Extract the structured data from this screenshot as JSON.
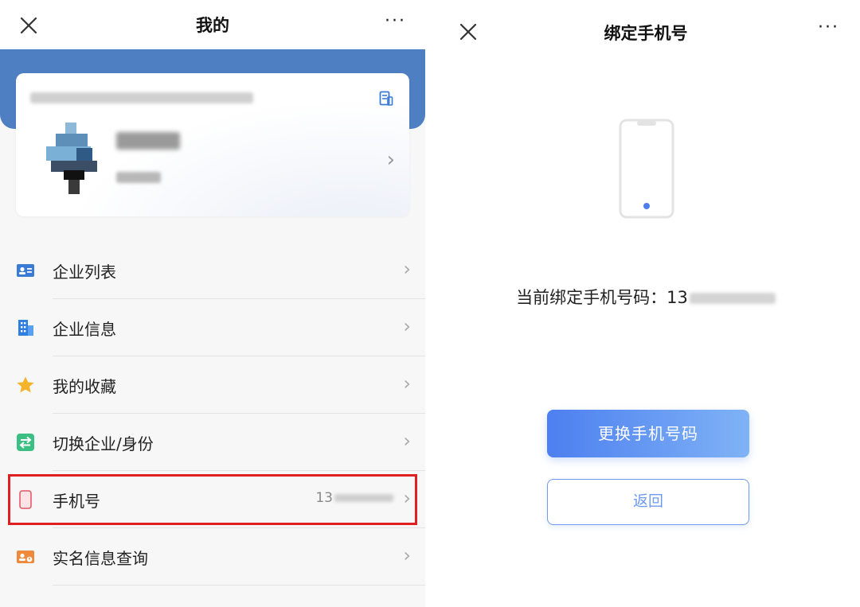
{
  "left": {
    "title": "我的",
    "more": "···",
    "menu": [
      {
        "label": "企业列表",
        "icon": "contact-card-icon",
        "color": "#3a7bd5"
      },
      {
        "label": "企业信息",
        "icon": "building-icon",
        "color": "#2f7fe0"
      },
      {
        "label": "我的收藏",
        "icon": "star-icon",
        "color": "#f3b32a"
      },
      {
        "label": "切换企业/身份",
        "icon": "switch-icon",
        "color": "#3cbf83"
      },
      {
        "label": "手机号",
        "icon": "phone-icon",
        "color": "#e8697a",
        "value": "13"
      },
      {
        "label": "实名信息查询",
        "icon": "id-card-icon",
        "color": "#ef8a3d"
      }
    ]
  },
  "right": {
    "title": "绑定手机号",
    "more": "···",
    "current_label": "当前绑定手机号码：",
    "current_prefix": "13",
    "change_button": "更换手机号码",
    "back_button": "返回"
  },
  "colors": {
    "banner": "#4d7fc2",
    "accent": "#4d7ff0",
    "highlight": "#e02020"
  }
}
